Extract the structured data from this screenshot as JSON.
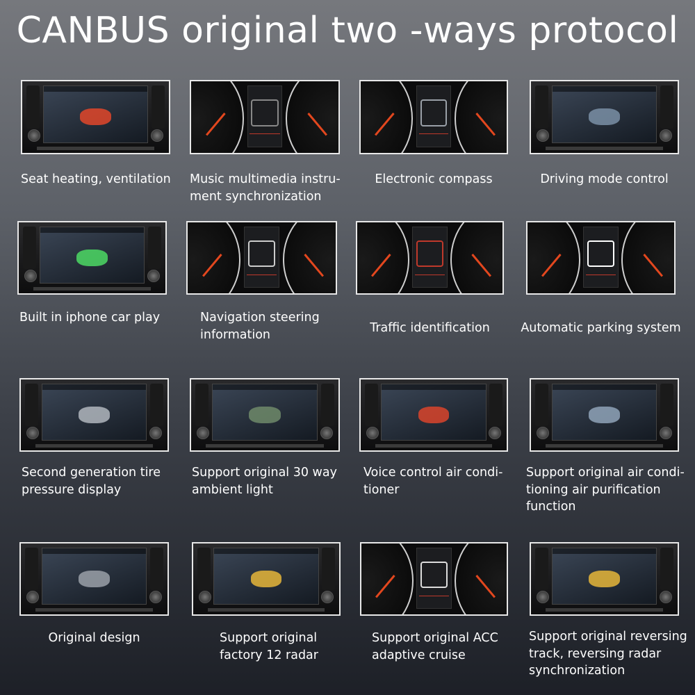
{
  "title": "CANBUS original two -ways protocol",
  "features": [
    {
      "caption": "Seat heating, ventilation",
      "image": "seat-heating-screen",
      "type": "headunit",
      "accent": "#e2462a"
    },
    {
      "caption": "Music multimedia instru-\nment synchronization",
      "image": "cluster-music-display",
      "type": "cluster",
      "accent": "#888888"
    },
    {
      "caption": "Electronic compass",
      "image": "cluster-compass-display",
      "type": "cluster",
      "accent": "#9aa0a8"
    },
    {
      "caption": "Driving mode control",
      "image": "driving-mode-screen",
      "type": "headunit",
      "accent": "#7a8fa6"
    },
    {
      "caption": "Built in iphone car play",
      "image": "carplay-screen",
      "type": "headunit",
      "accent": "#4cd964"
    },
    {
      "caption": "Navigation steering\ninformation",
      "image": "cluster-navigation-display",
      "type": "cluster",
      "accent": "#cccccc"
    },
    {
      "caption": "Traffic identification",
      "image": "cluster-traffic-display",
      "type": "cluster",
      "accent": "#c0392b"
    },
    {
      "caption": "Automatic parking system",
      "image": "cluster-parking-display",
      "type": "cluster",
      "accent": "#ffffff"
    },
    {
      "caption": "Second generation tire\npressure display",
      "image": "tire-pressure-screen",
      "type": "headunit",
      "accent": "#b0b6bd"
    },
    {
      "caption": "Support original 30 way\nambient light",
      "image": "ambient-light-menu",
      "type": "headunit",
      "accent": "#6f8a6a"
    },
    {
      "caption": "Voice control air condi-\ntioner",
      "image": "air-conditioner-screen",
      "type": "headunit",
      "accent": "#d9442b"
    },
    {
      "caption": "Support original air condi-\ntioning air purification\nfunction",
      "image": "air-purification-screen",
      "type": "headunit",
      "accent": "#8fa3b8"
    },
    {
      "caption": "Original design",
      "image": "original-menu-screen",
      "type": "headunit",
      "accent": "#9aa0a8"
    },
    {
      "caption": "Support original\nfactory 12 radar",
      "image": "radar-camera-screen",
      "type": "headunit",
      "accent": "#e6b63a"
    },
    {
      "caption": "Support original ACC\nadaptive cruise",
      "image": "cluster-acc-display",
      "type": "cluster",
      "accent": "#dddddd"
    },
    {
      "caption": "Support original reversing\ntrack, reversing radar\nsynchronization",
      "image": "reversing-track-screen",
      "type": "headunit",
      "accent": "#e6b63a"
    }
  ]
}
